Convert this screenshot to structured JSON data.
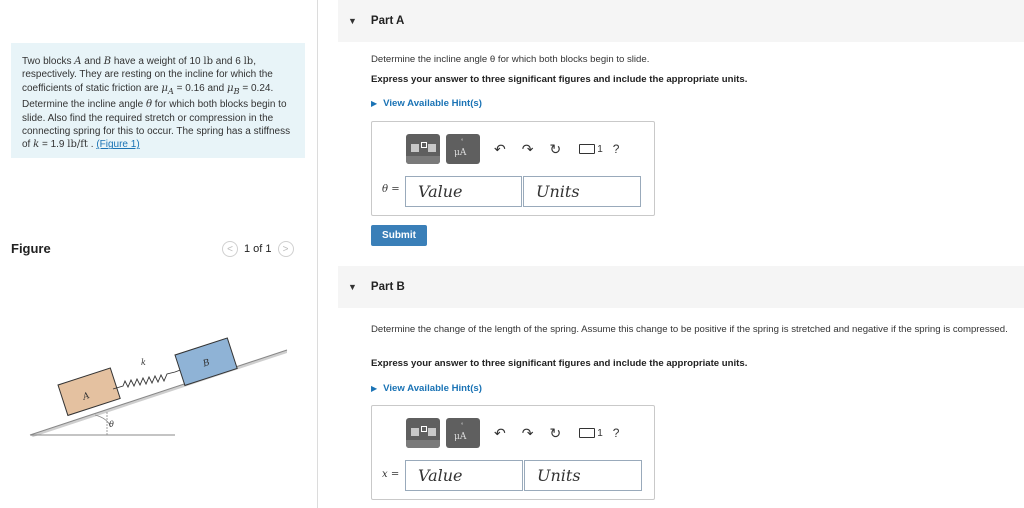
{
  "problem": {
    "text_1": "Two blocks ",
    "var_A": "A",
    "text_2": " and ",
    "var_B": "B",
    "text_3": " have a weight of 10 ",
    "unit_lb1": "lb",
    "text_4": " and 6 ",
    "unit_lb2": "lb",
    "text_5": ", respectively. They are resting on the incline for which the coefficients of static friction are ",
    "mu_A": "μ",
    "mu_A_sub": "A",
    "text_6": " = 0.16 and ",
    "mu_B": "μ",
    "mu_B_sub": "B",
    "text_7": " = 0.24. Determine the incline angle ",
    "theta": "θ",
    "text_8": " for which both blocks begin to slide. Also find the required stretch or compression in the connecting spring for this to occur. The spring has a stiffness of ",
    "var_k": "k",
    "text_9": " = 1.9 ",
    "unit_k": "lb/ft",
    "text_10": " . ",
    "figure_link": "(Figure 1)"
  },
  "figure": {
    "label": "Figure",
    "pager": "1 of 1",
    "block_a": "A",
    "block_b": "B",
    "spring": "k",
    "angle": "θ"
  },
  "part_a": {
    "title": "Part A",
    "question": "Determine the incline angle θ for which both blocks begin to slide.",
    "instruction": "Express your answer to three significant figures and include the appropriate units.",
    "hint": "View Available Hint(s)",
    "var_label": "θ =",
    "value_placeholder": "Value",
    "units_placeholder": "Units",
    "submit": "Submit"
  },
  "part_b": {
    "title": "Part B",
    "question": "Determine the change of the length of  the spring. Assume this change to be positive if the spring is stretched and negative if the spring is compressed.",
    "instruction": "Express your answer to three significant figures and include the appropriate units.",
    "hint": "View Available Hint(s)",
    "var_label": "x =",
    "value_placeholder": "Value",
    "units_placeholder": "Units"
  },
  "toolbar": {
    "mu_symbol": "μA",
    "help": "?",
    "kbd_label": "1"
  }
}
